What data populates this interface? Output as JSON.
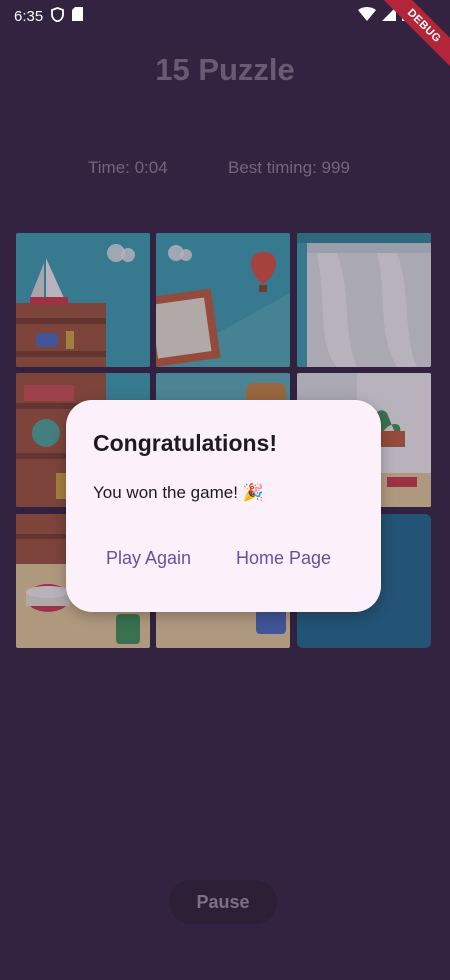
{
  "status_bar": {
    "time": "6:35",
    "debug_label": "DEBUG"
  },
  "game": {
    "title": "15 Puzzle",
    "time_label": "Time: 0:04",
    "best_label": "Best timing: 999",
    "pause_label": "Pause"
  },
  "dialog": {
    "title": "Congratulations!",
    "message": "You won the game! 🎉",
    "play_again_label": "Play Again",
    "home_page_label": "Home Page"
  },
  "colors": {
    "background": "#342340",
    "dialog_bg": "#fcf0fb",
    "accent": "#6750a4",
    "empty_tile": "#1b6e93"
  }
}
